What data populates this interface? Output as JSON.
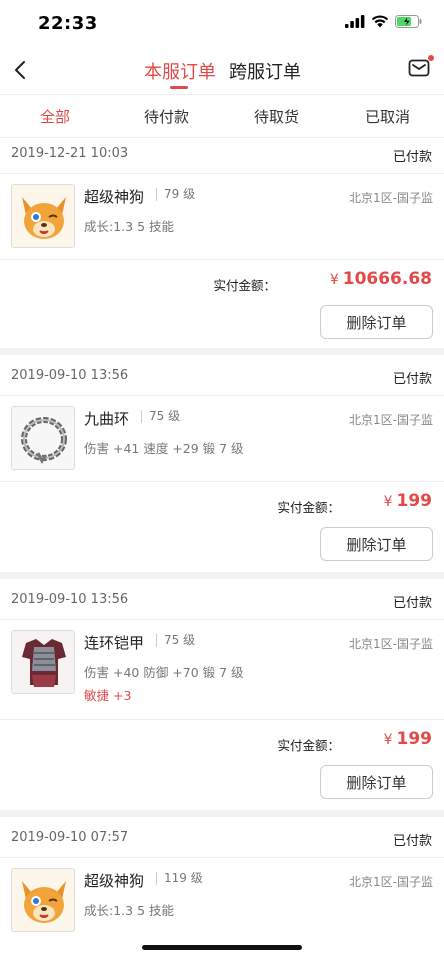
{
  "status_bar": {
    "time": "22:33"
  },
  "nav": {
    "tabs": [
      {
        "label": "本服订单",
        "active": true
      },
      {
        "label": "跨服订单",
        "active": false
      }
    ],
    "back_icon": "chevron-left-icon",
    "message_icon": "mail-icon"
  },
  "filters": [
    {
      "label": "全部",
      "active": true
    },
    {
      "label": "待付款",
      "active": false
    },
    {
      "label": "待取货",
      "active": false
    },
    {
      "label": "已取消",
      "active": false
    }
  ],
  "orders": [
    {
      "time": "2019-12-21 10:03",
      "status": "已付款",
      "item": {
        "name": "超级神狗",
        "level": "79 级",
        "server": "北京1区-国子监",
        "attr": "成长:1.3 5 技能",
        "attr2": ""
      },
      "pay_label": "实付金额：",
      "currency": "¥",
      "amount": "10666.68",
      "delete_label": "删除订单"
    },
    {
      "time": "2019-09-10 13:56",
      "status": "已付款",
      "item": {
        "name": "九曲环",
        "level": "75 级",
        "server": "北京1区-国子监",
        "attr": "伤害 +41 速度 +29 锻 7 级",
        "attr2": ""
      },
      "pay_label": "实付金额：",
      "currency": "¥",
      "amount": "199",
      "delete_label": "删除订单"
    },
    {
      "time": "2019-09-10 13:56",
      "status": "已付款",
      "item": {
        "name": "连环铠甲",
        "level": "75 级",
        "server": "北京1区-国子监",
        "attr": "伤害 +40 防御 +70 锻 7 级",
        "attr2": "敏捷 +3"
      },
      "pay_label": "实付金额：",
      "currency": "¥",
      "amount": "199",
      "delete_label": "删除订单"
    },
    {
      "time": "2019-09-10 07:57",
      "status": "已付款",
      "item": {
        "name": "超级神狗",
        "level": "119 级",
        "server": "北京1区-国子监",
        "attr": "成长:1.3 5 技能",
        "attr2": ""
      }
    }
  ],
  "colors": {
    "accent": "#e14a48",
    "divider": "#f2f2f2"
  }
}
